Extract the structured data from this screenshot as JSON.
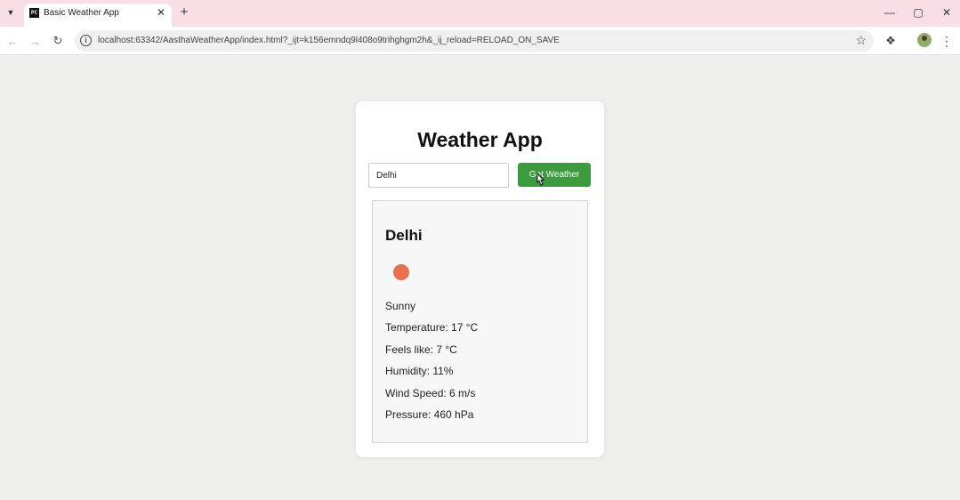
{
  "browser": {
    "tab_title": "Basic Weather App",
    "tab_favicon_text": "PC",
    "url": "localhost:63342/AasthaWeatherApp/index.html?_ijt=k156emndq9l408o9trihghgm2h&_ij_reload=RELOAD_ON_SAVE"
  },
  "icons": {
    "tab_list": "chevron-down-icon",
    "close_tab": "close-icon",
    "new_tab": "plus-icon",
    "minimize": "minimize-icon",
    "maximize": "maximize-icon",
    "close_window": "close-icon",
    "back": "back-arrow-icon",
    "forward": "forward-arrow-icon",
    "reload": "reload-icon",
    "site_info": "info-icon",
    "bookmark": "star-icon",
    "extensions": "puzzle-icon",
    "menu": "kebab-menu-icon",
    "weather": "sun-icon"
  },
  "app": {
    "title": "Weather App",
    "search": {
      "value": "Delhi",
      "button_label": "Get Weather"
    },
    "result": {
      "city": "Delhi",
      "description": "Sunny",
      "temperature": "Temperature: 17 °C",
      "feels_like": "Feels like: 7 °C",
      "humidity": "Humidity: 11%",
      "wind_speed": "Wind Speed: 6 m/s",
      "pressure": "Pressure: 460 hPa"
    }
  },
  "colors": {
    "tabbar_bg": "#f9dfe5",
    "page_bg": "#efefed",
    "button_bg": "#3c9a3f",
    "weather_icon": "#e8704e"
  }
}
